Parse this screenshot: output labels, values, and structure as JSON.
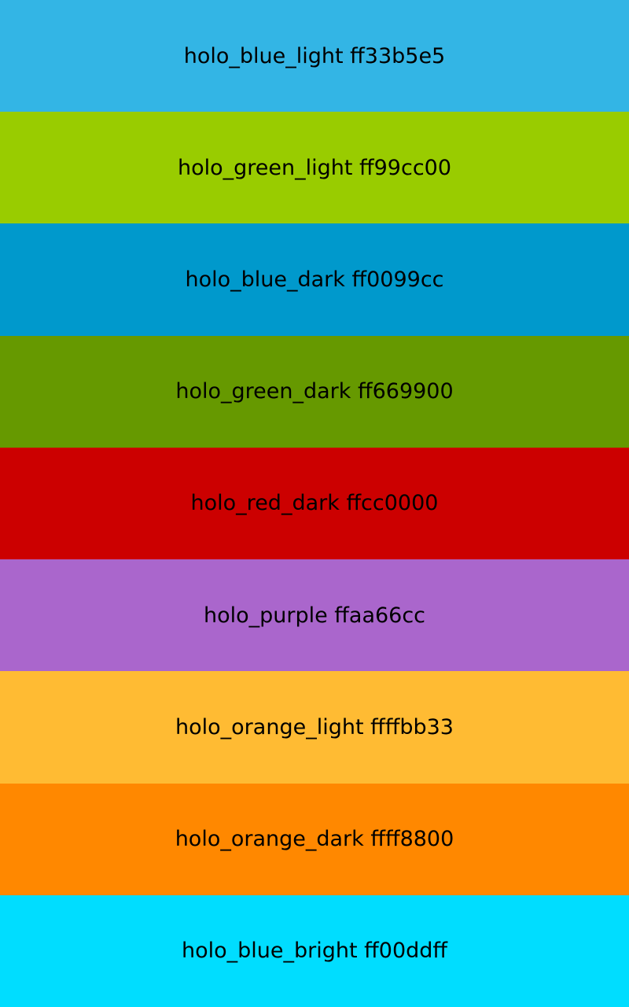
{
  "swatches": [
    {
      "label": "holo_blue_light ff33b5e5",
      "color": "#33b5e5"
    },
    {
      "label": "holo_green_light ff99cc00",
      "color": "#99cc00"
    },
    {
      "label": "holo_blue_dark ff0099cc",
      "color": "#0099cc"
    },
    {
      "label": "holo_green_dark ff669900",
      "color": "#669900"
    },
    {
      "label": "holo_red_dark ffcc0000",
      "color": "#cc0000"
    },
    {
      "label": "holo_purple ffaa66cc",
      "color": "#aa66cc"
    },
    {
      "label": "holo_orange_light ffffbb33",
      "color": "#ffbb33"
    },
    {
      "label": "holo_orange_dark ffff8800",
      "color": "#ff8800"
    },
    {
      "label": "holo_blue_bright ff00ddff",
      "color": "#00ddff"
    }
  ]
}
